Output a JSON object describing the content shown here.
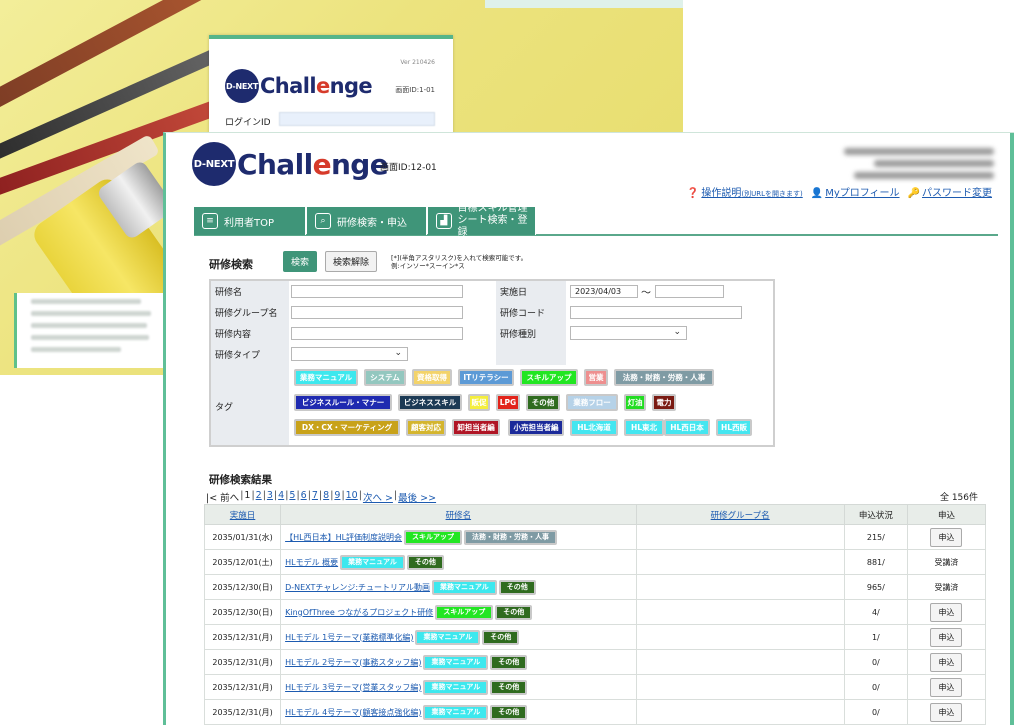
{
  "login": {
    "version": "Ver 210426",
    "screen_id": "画面ID:1-01",
    "login_id_label": "ログインID"
  },
  "logo": {
    "badge": "D-NEXT",
    "word_a": "Chall",
    "word_b": "e",
    "word_c": "nge"
  },
  "header": {
    "screen_id": "画面ID:12-01",
    "links": {
      "manual": "操作説明",
      "manual_note": "(別URLを開きます)",
      "profile": "Myプロフィール",
      "password": "パスワード変更"
    }
  },
  "tabs": [
    {
      "label": "利用者TOP"
    },
    {
      "label": "研修検索・申込"
    },
    {
      "label": "目標スキル管理",
      "label2": "シート検索・登録"
    }
  ],
  "search": {
    "title": "研修検索",
    "search_button": "検索",
    "clear_button": "検索解除",
    "hint_line1": "[*](半角アスタリスク)を入れて検索可能です。",
    "hint_line2": "例:インソー*スーイン*ス",
    "fields": {
      "course_name": "研修名",
      "group_name": "研修グループ名",
      "content": "研修内容",
      "type": "研修タイプ",
      "tag": "タグ",
      "date": "実施日",
      "date_from": "2023/04/03",
      "tilde": "〜",
      "code": "研修コード",
      "category": "研修種別"
    }
  },
  "tags": [
    {
      "label": "業務マニュアル",
      "bg": "#3de8ee",
      "fg": "#ffffff"
    },
    {
      "label": "システム",
      "bg": "#93c7bf",
      "fg": "#ffffff"
    },
    {
      "label": "資格取得",
      "bg": "#f3d36a",
      "fg": "#ffffff"
    },
    {
      "label": "ITリテラシー",
      "bg": "#5c9ad6",
      "fg": "#ffffff"
    },
    {
      "label": "スキルアップ",
      "bg": "#22e622",
      "fg": "#ffffff"
    },
    {
      "label": "営業",
      "bg": "#ee8f8f",
      "fg": "#ffffff"
    },
    {
      "label": "法務・財務・労務・人事",
      "bg": "#7f9ba4",
      "fg": "#ffffff"
    },
    {
      "label": "ビジネスルール・マナー",
      "bg": "#1f2ab0",
      "fg": "#ffffff"
    },
    {
      "label": "ビジネススキル",
      "bg": "#1c3a55",
      "fg": "#ffffff"
    },
    {
      "label": "販促",
      "bg": "#f4ee3c",
      "fg": "#ffffff"
    },
    {
      "label": "LPG",
      "bg": "#e2231a",
      "fg": "#ffffff"
    },
    {
      "label": "その他",
      "bg": "#2f6b1f",
      "fg": "#ffffff"
    },
    {
      "label": "業務フロー",
      "bg": "#b6d2e8",
      "fg": "#ffffff"
    },
    {
      "label": "灯油",
      "bg": "#22dd22",
      "fg": "#ffffff"
    },
    {
      "label": "電力",
      "bg": "#7a1a12",
      "fg": "#ffffff"
    },
    {
      "label": "DX・CX・マーケティング",
      "bg": "#c8a21a",
      "fg": "#ffffff"
    },
    {
      "label": "顧客対応",
      "bg": "#d4b52e",
      "fg": "#ffffff"
    },
    {
      "label": "卸担当者編",
      "bg": "#b01525",
      "fg": "#ffffff"
    },
    {
      "label": "小売担当者編",
      "bg": "#1b2a9a",
      "fg": "#ffffff"
    },
    {
      "label": "HL北海道",
      "bg": "#44e6f0",
      "fg": "#ffffff"
    },
    {
      "label": "HL東北",
      "bg": "#44e6f0",
      "fg": "#ffffff"
    },
    {
      "label": "HL西日本",
      "bg": "#44e6f0",
      "fg": "#ffffff"
    },
    {
      "label": "HL西販",
      "bg": "#44e6f0",
      "fg": "#ffffff"
    }
  ],
  "results": {
    "title": "研修検索結果",
    "pager": {
      "first": "|< 前へ",
      "pages": [
        "1",
        "2",
        "3",
        "4",
        "5",
        "6",
        "7",
        "8",
        "9",
        "10"
      ],
      "next": "次へ >",
      "last": "最後 >>"
    },
    "total": "全 156件",
    "columns": {
      "date": "実施日",
      "name": "研修名",
      "group": "研修グループ名",
      "status": "申込状況",
      "apply": "申込"
    },
    "rows": [
      {
        "date": "2035/01/31(水)",
        "name": "【HL西日本】HL評価制度説明会",
        "tags": [
          "スキルアップ",
          "法務・財務・労務・人事"
        ],
        "status": "215/",
        "apply": "申込"
      },
      {
        "date": "2035/12/01(土)",
        "name": "HLモデル 概要",
        "tags": [
          "業務マニュアル",
          "その他"
        ],
        "status": "881/",
        "apply": "受講済"
      },
      {
        "date": "2035/12/30(日)",
        "name": "D-NEXTチャレンジ:チュートリアル動画",
        "tags": [
          "業務マニュアル",
          "その他"
        ],
        "status": "965/",
        "apply": "受講済"
      },
      {
        "date": "2035/12/30(日)",
        "name": "KingOfThree つながるプロジェクト研修",
        "tags": [
          "スキルアップ",
          "その他"
        ],
        "status": "4/",
        "apply": "申込"
      },
      {
        "date": "2035/12/31(月)",
        "name": "HLモデル 1号テーマ(業務標準化編)",
        "tags": [
          "業務マニュアル",
          "その他"
        ],
        "status": "1/",
        "apply": "申込"
      },
      {
        "date": "2035/12/31(月)",
        "name": "HLモデル 2号テーマ(事務スタッフ編)",
        "tags": [
          "業務マニュアル",
          "その他"
        ],
        "status": "0/",
        "apply": "申込"
      },
      {
        "date": "2035/12/31(月)",
        "name": "HLモデル 3号テーマ(営業スタッフ編)",
        "tags": [
          "業務マニュアル",
          "その他"
        ],
        "status": "0/",
        "apply": "申込"
      },
      {
        "date": "2035/12/31(月)",
        "name": "HLモデル 4号テーマ(顧客接点強化編)",
        "tags": [
          "業務マニュアル",
          "その他"
        ],
        "status": "0/",
        "apply": "申込"
      }
    ]
  }
}
